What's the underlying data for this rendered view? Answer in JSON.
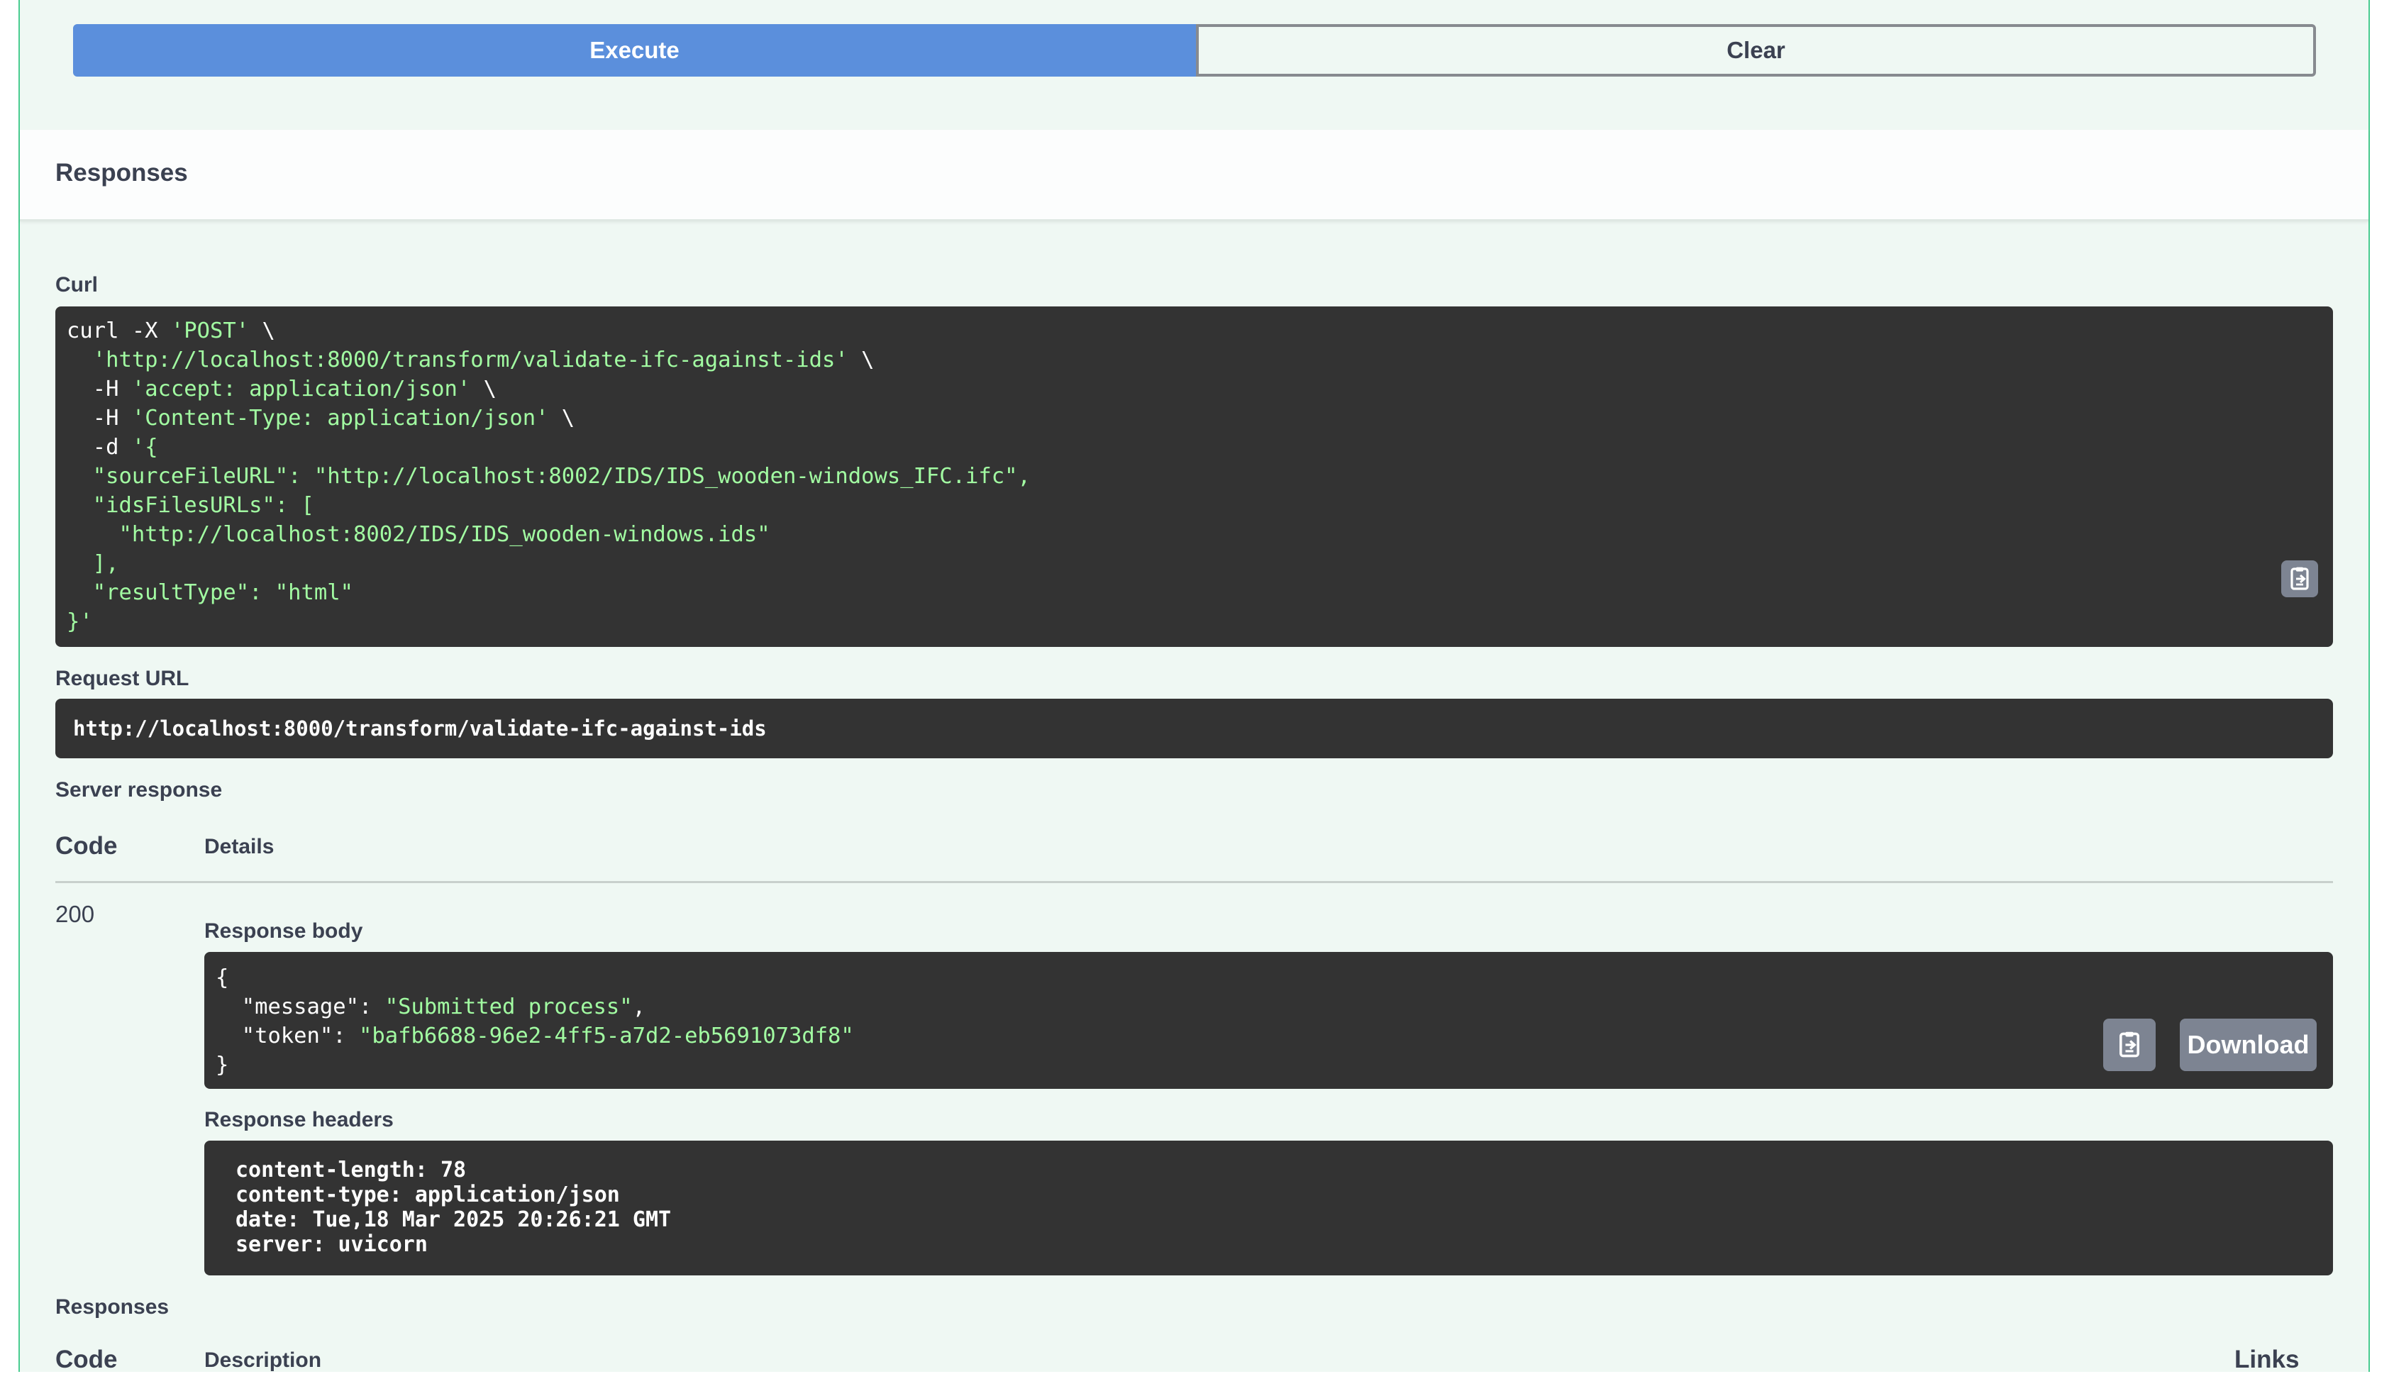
{
  "buttons": {
    "execute": "Execute",
    "clear": "Clear"
  },
  "responses_title": "Responses",
  "curl": {
    "label": "Curl",
    "lines": [
      {
        "pre": "curl -X ",
        "str": "'POST'",
        "post": " \\"
      },
      {
        "pre": "  ",
        "str": "'http://localhost:8000/transform/validate-ifc-against-ids'",
        "post": " \\"
      },
      {
        "pre": "  -H ",
        "str": "'accept: application/json'",
        "post": " \\"
      },
      {
        "pre": "  -H ",
        "str": "'Content-Type: application/json'",
        "post": " \\"
      },
      {
        "pre": "  -d ",
        "str": "'{",
        "post": ""
      },
      {
        "pre": "",
        "str": "  \"sourceFileURL\": \"http://localhost:8002/IDS/IDS_wooden-windows_IFC.ifc\",",
        "post": ""
      },
      {
        "pre": "",
        "str": "  \"idsFilesURLs\": [",
        "post": ""
      },
      {
        "pre": "",
        "str": "    \"http://localhost:8002/IDS/IDS_wooden-windows.ids\"",
        "post": ""
      },
      {
        "pre": "",
        "str": "  ],",
        "post": ""
      },
      {
        "pre": "",
        "str": "  \"resultType\": \"html\"",
        "post": ""
      },
      {
        "pre": "",
        "str": "}'",
        "post": ""
      }
    ]
  },
  "request_url": {
    "label": "Request URL",
    "value": "http://localhost:8000/transform/validate-ifc-against-ids"
  },
  "server_response": {
    "label": "Server response",
    "col_code": "Code",
    "col_details": "Details",
    "code": "200",
    "body_label": "Response body",
    "body_lines": [
      {
        "key": "{",
        "val": "",
        "tail": ""
      },
      {
        "key": "  \"message\": ",
        "val": "\"Submitted process\"",
        "tail": ","
      },
      {
        "key": "  \"token\": ",
        "val": "\"bafb6688-96e2-4ff5-a7d2-eb5691073df8\"",
        "tail": ""
      },
      {
        "key": "}",
        "val": "",
        "tail": ""
      }
    ],
    "download": "Download",
    "headers_label": "Response headers",
    "headers": [
      "content-length: 78",
      "content-type: application/json",
      "date: Tue,18 Mar 2025 20:26:21 GMT",
      "server: uvicorn"
    ]
  },
  "bottom": {
    "label": "Responses",
    "col_code": "Code",
    "col_description": "Description",
    "col_links": "Links"
  },
  "colors": {
    "execute": "#5b8fdc",
    "code_bg": "#333333",
    "string": "#a2fca2",
    "success_border": "#49cc90"
  },
  "icons": {
    "copy": "copy-to-clipboard-icon"
  }
}
